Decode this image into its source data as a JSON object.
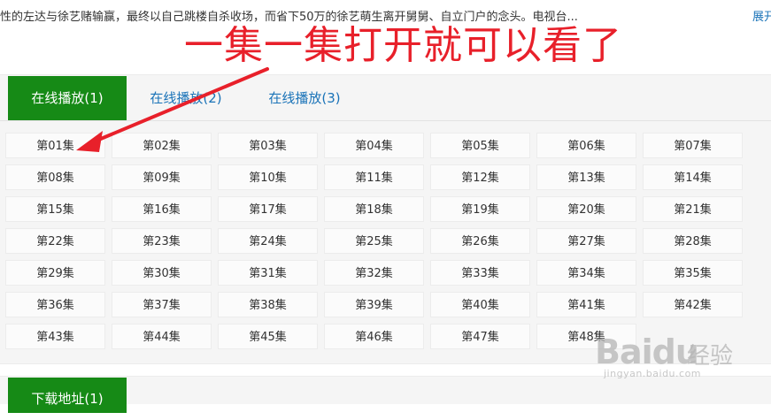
{
  "description": {
    "text": "性的左达与徐艺赌输赢，最终以自己跳楼自杀收场，而省下50万的徐艺萌生离开舅舅、自立门户的念头。电视台...",
    "expand_label": "展开"
  },
  "annotation": {
    "text": "一集一集打开就可以看了",
    "color": "#e8202a"
  },
  "tabs": [
    {
      "label": "在线播放(1)",
      "active": true
    },
    {
      "label": "在线播放(2)",
      "active": false
    },
    {
      "label": "在线播放(3)",
      "active": false
    }
  ],
  "episodes": [
    "第01集",
    "第02集",
    "第03集",
    "第04集",
    "第05集",
    "第06集",
    "第07集",
    "第08集",
    "第09集",
    "第10集",
    "第11集",
    "第12集",
    "第13集",
    "第14集",
    "第15集",
    "第16集",
    "第17集",
    "第18集",
    "第19集",
    "第20集",
    "第21集",
    "第22集",
    "第23集",
    "第24集",
    "第25集",
    "第26集",
    "第27集",
    "第28集",
    "第29集",
    "第30集",
    "第31集",
    "第32集",
    "第33集",
    "第34集",
    "第35集",
    "第36集",
    "第37集",
    "第38集",
    "第39集",
    "第40集",
    "第41集",
    "第42集",
    "第43集",
    "第44集",
    "第45集",
    "第46集",
    "第47集",
    "第48集"
  ],
  "download": {
    "label": "下载地址(1)"
  },
  "watermark": {
    "logo": "Baidu",
    "brand": "经验",
    "url": "jingyan.baidu.com"
  },
  "colors": {
    "accent_green": "#168a16",
    "link_blue": "#1a73b8",
    "annotation_red": "#e8202a"
  }
}
